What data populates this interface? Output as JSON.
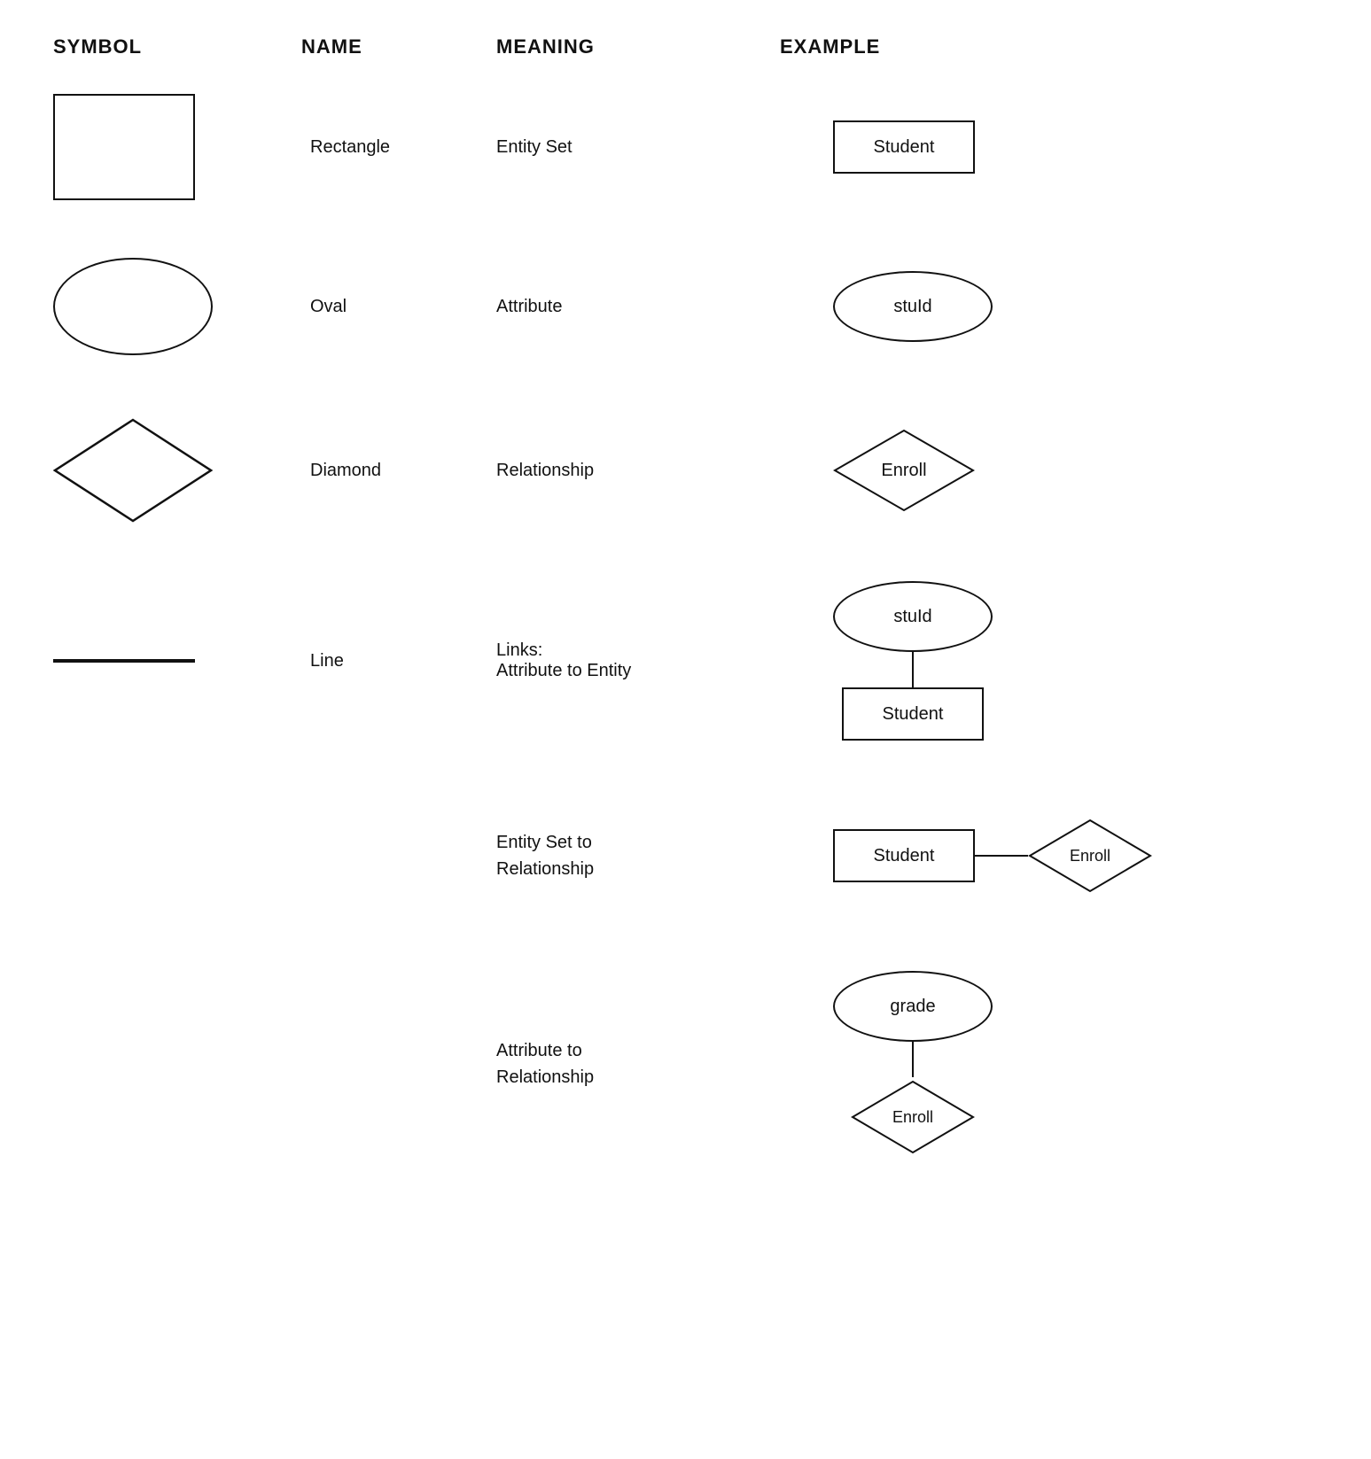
{
  "header": {
    "col1": "SYMBOL",
    "col2": "NAME",
    "col3": "MEANING",
    "col4": "EXAMPLE"
  },
  "rows": [
    {
      "id": "rectangle",
      "name": "Rectangle",
      "meaning": "Entity Set",
      "example_label": "Student",
      "symbol_type": "rect",
      "example_type": "rect"
    },
    {
      "id": "oval",
      "name": "Oval",
      "meaning": "Attribute",
      "example_label": "stuId",
      "symbol_type": "oval",
      "example_type": "oval"
    },
    {
      "id": "diamond",
      "name": "Diamond",
      "meaning": "Relationship",
      "example_label": "Enroll",
      "symbol_type": "diamond",
      "example_type": "diamond"
    },
    {
      "id": "line",
      "name": "Line",
      "meaning_line1": "Links:",
      "meaning_line2": "Attribute to Entity",
      "example_oval": "stuId",
      "example_rect": "Student",
      "symbol_type": "line",
      "example_type": "line-linked"
    }
  ],
  "extra_rows": [
    {
      "id": "entity-set-to-rel",
      "meaning_line1": "Entity Set to",
      "meaning_line2": "Relationship",
      "left_label": "Student",
      "right_label": "Enroll",
      "example_type": "entity-rel"
    },
    {
      "id": "attr-to-rel",
      "meaning_line1": "Attribute to",
      "meaning_line2": "Relationship",
      "oval_label": "grade",
      "diamond_label": "Enroll",
      "example_type": "attr-rel"
    }
  ]
}
